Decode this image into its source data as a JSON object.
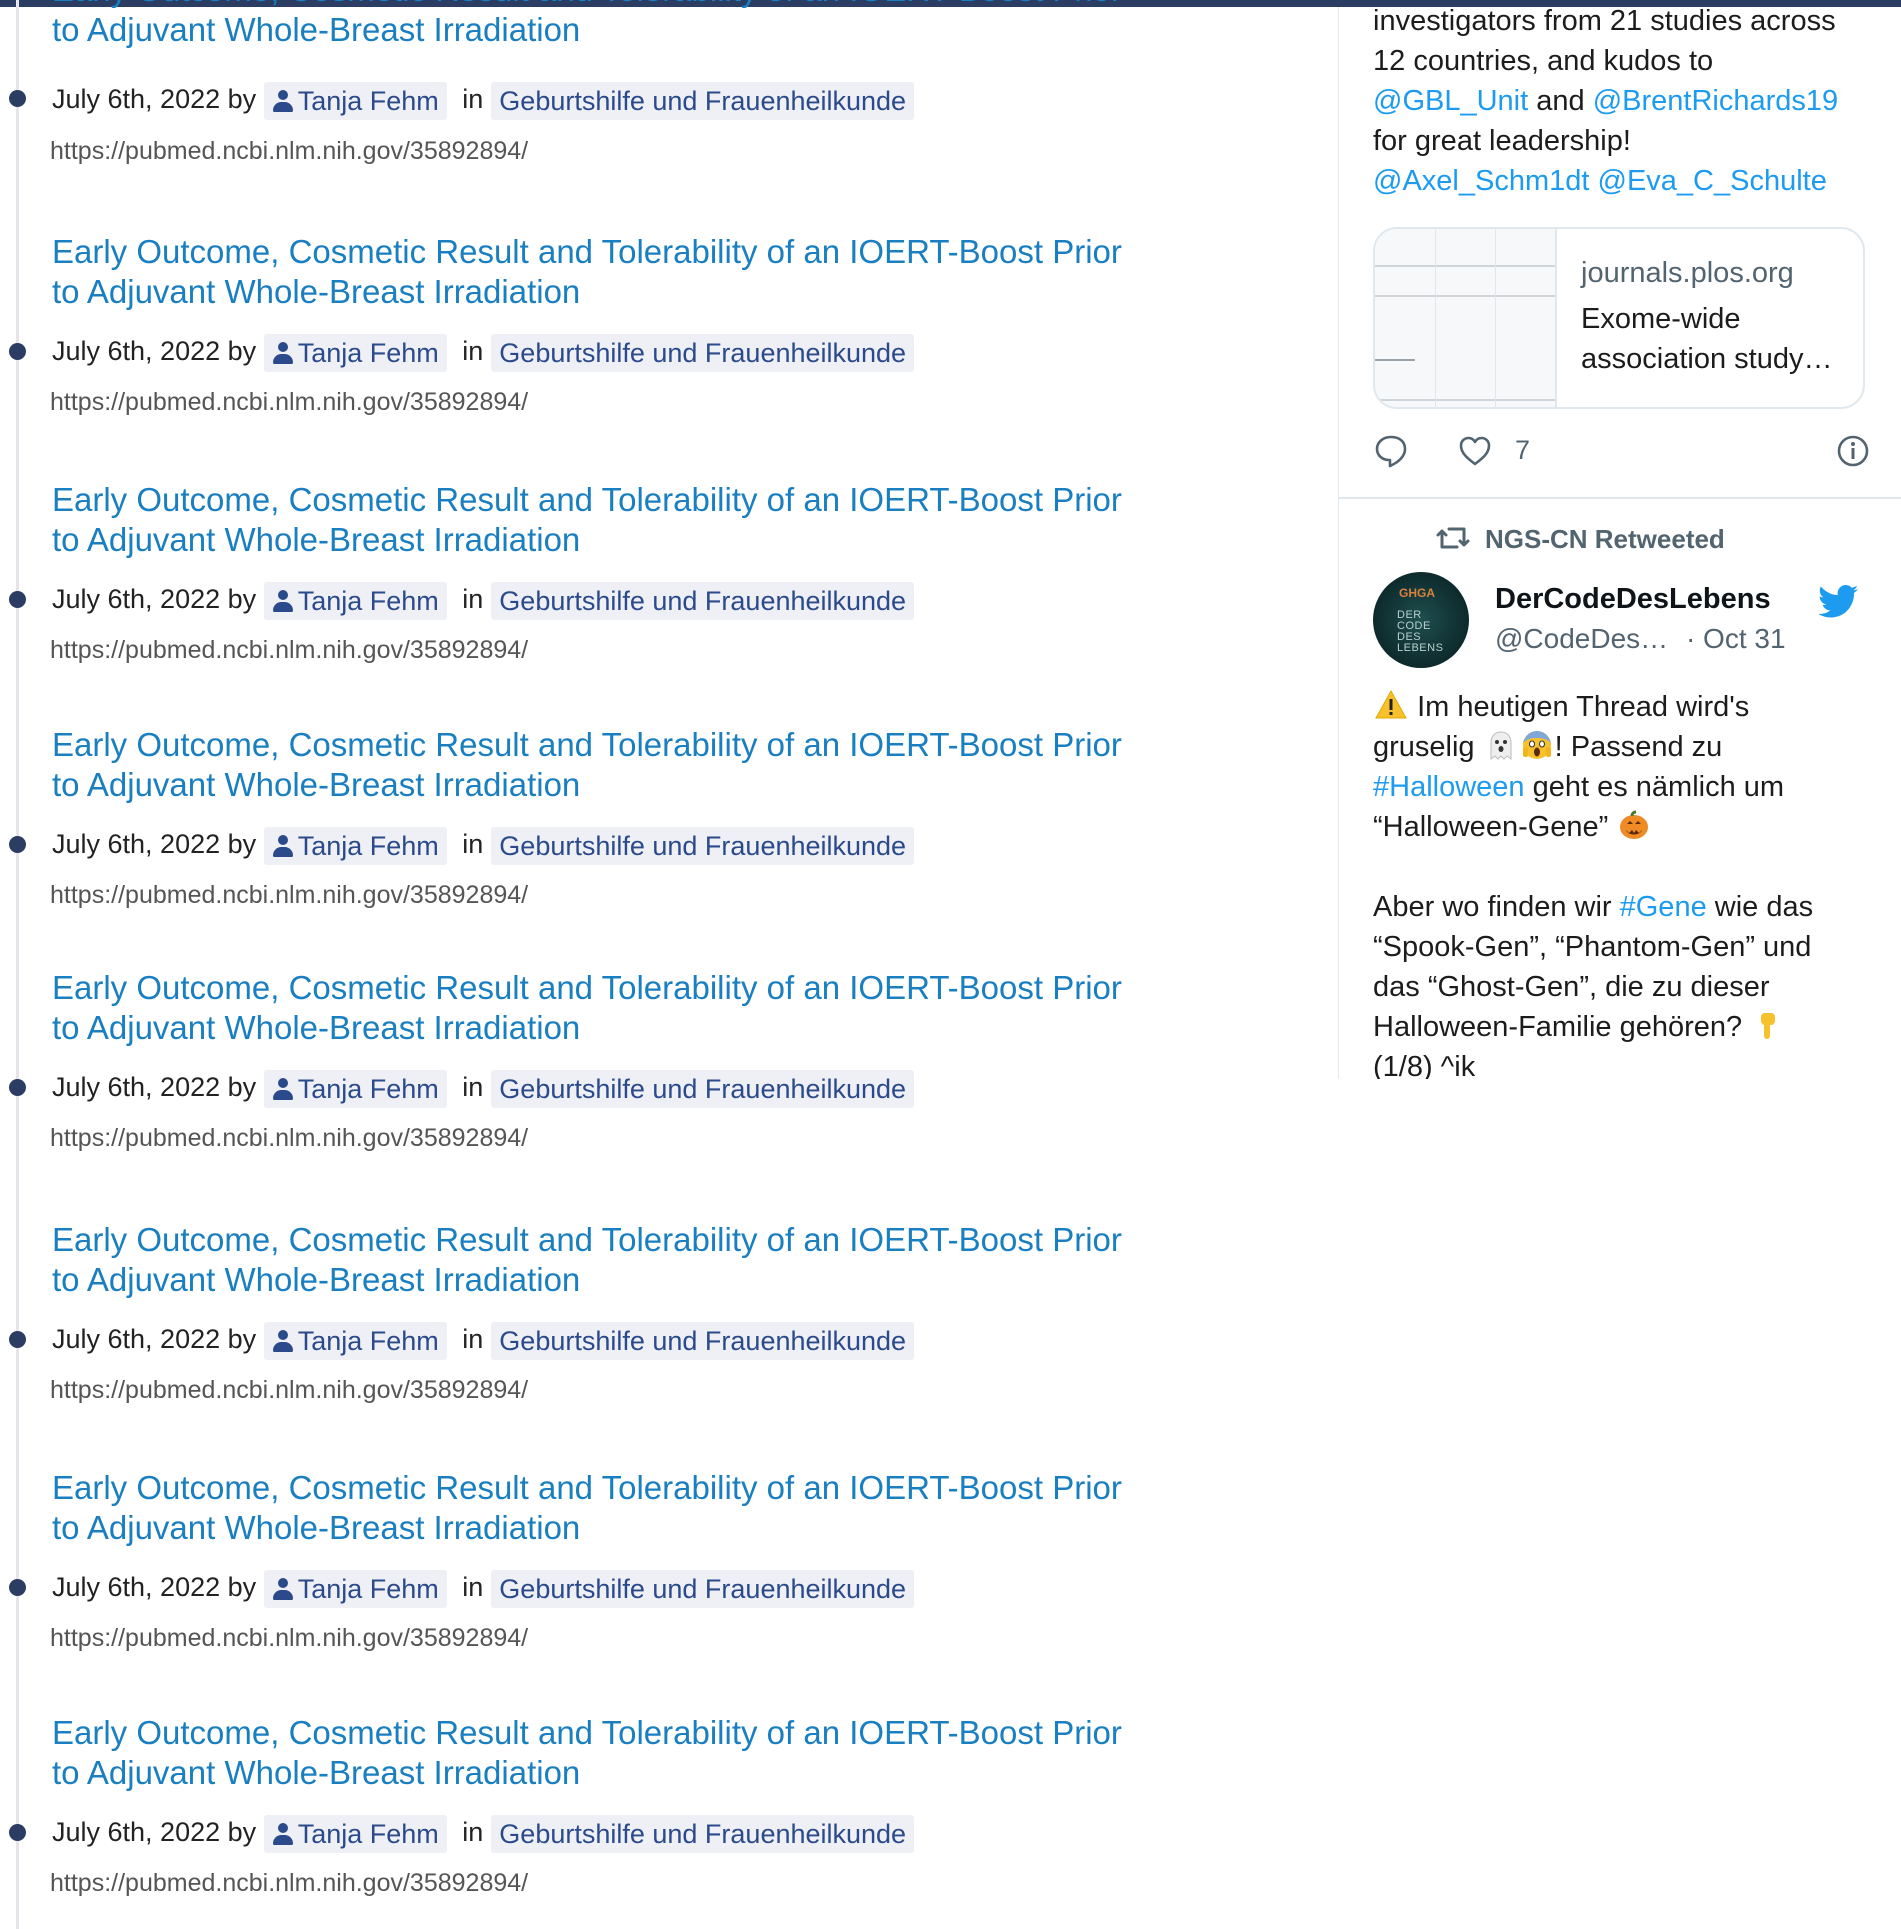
{
  "posts": [
    {
      "title": "Early Outcome, Cosmetic Result and Tolerability of an IOERT-Boost Prior to Adjuvant Whole-Breast Irradiation",
      "date": "July 6th, 2022",
      "by": "by",
      "author": "Tanja Fehm",
      "in": "in",
      "category": "Geburtshilfe und Frauenheilkunde",
      "url": "https://pubmed.ncbi.nlm.nih.gov/35892894/"
    },
    {
      "title": "Early Outcome, Cosmetic Result and Tolerability of an IOERT-Boost Prior to Adjuvant Whole-Breast Irradiation",
      "date": "July 6th, 2022",
      "by": "by",
      "author": "Tanja Fehm",
      "in": "in",
      "category": "Geburtshilfe und Frauenheilkunde",
      "url": "https://pubmed.ncbi.nlm.nih.gov/35892894/"
    },
    {
      "title": "Early Outcome, Cosmetic Result and Tolerability of an IOERT-Boost Prior to Adjuvant Whole-Breast Irradiation",
      "date": "July 6th, 2022",
      "by": "by",
      "author": "Tanja Fehm",
      "in": "in",
      "category": "Geburtshilfe und Frauenheilkunde",
      "url": "https://pubmed.ncbi.nlm.nih.gov/35892894/"
    },
    {
      "title": "Early Outcome, Cosmetic Result and Tolerability of an IOERT-Boost Prior to Adjuvant Whole-Breast Irradiation",
      "date": "July 6th, 2022",
      "by": "by",
      "author": "Tanja Fehm",
      "in": "in",
      "category": "Geburtshilfe und Frauenheilkunde",
      "url": "https://pubmed.ncbi.nlm.nih.gov/35892894/"
    },
    {
      "title": "Early Outcome, Cosmetic Result and Tolerability of an IOERT-Boost Prior to Adjuvant Whole-Breast Irradiation",
      "date": "July 6th, 2022",
      "by": "by",
      "author": "Tanja Fehm",
      "in": "in",
      "category": "Geburtshilfe und Frauenheilkunde",
      "url": "https://pubmed.ncbi.nlm.nih.gov/35892894/"
    },
    {
      "title": "Early Outcome, Cosmetic Result and Tolerability of an IOERT-Boost Prior to Adjuvant Whole-Breast Irradiation",
      "date": "July 6th, 2022",
      "by": "by",
      "author": "Tanja Fehm",
      "in": "in",
      "category": "Geburtshilfe und Frauenheilkunde",
      "url": "https://pubmed.ncbi.nlm.nih.gov/35892894/"
    },
    {
      "title": "Early Outcome, Cosmetic Result and Tolerability of an IOERT-Boost Prior to Adjuvant Whole-Breast Irradiation",
      "date": "July 6th, 2022",
      "by": "by",
      "author": "Tanja Fehm",
      "in": "in",
      "category": "Geburtshilfe und Frauenheilkunde",
      "url": "https://pubmed.ncbi.nlm.nih.gov/35892894/"
    },
    {
      "title": "Early Outcome, Cosmetic Result and Tolerability of an IOERT-Boost Prior to Adjuvant Whole-Breast Irradiation",
      "date": "July 6th, 2022",
      "by": "by",
      "author": "Tanja Fehm",
      "in": "in",
      "category": "Geburtshilfe und Frauenheilkunde",
      "url": "https://pubmed.ncbi.nlm.nih.gov/35892894/"
    }
  ],
  "twitter": {
    "tweet1": {
      "line1": "investigators from 21 studies across",
      "line2": "12 countries, and kudos to",
      "mention1": "@GBL_Unit",
      "and": "and",
      "mention2": "@BrentRichards19",
      "line4": "for great leadership!",
      "mention3": "@Axel_Schm1dt",
      "mention4": "@Eva_C_Schulte",
      "card_domain": "journals.plos.org",
      "card_title": "Exome-wide association study…",
      "like_count": "7",
      "icons": [
        "reply-icon",
        "heart-icon",
        "info-icon"
      ]
    },
    "retweet_label": "NGS-CN Retweeted",
    "tweet2": {
      "name": "DerCodeDesLebens",
      "handle": "@CodeDes…",
      "date": "· Oct 31",
      "avatar_top": "GHGA",
      "avatar_text": "DER CODE DES LEBENS",
      "p1_a": "Im heutigen Thread wird's",
      "p1_b": "gruselig",
      "p1_c": "! Passend zu",
      "hashtag1": "#Halloween",
      "p1_d": "geht es nämlich um",
      "p1_e": "“Halloween-Gene”",
      "p2_a": "Aber wo finden wir",
      "hashtag2": "#Gene",
      "p2_b": "wie das",
      "p2_c": "“Spook-Gen”, “Phantom-Gen” und",
      "p2_d": "das “Ghost-Gen”, die zu dieser",
      "p2_e": "Halloween-Familie gehören?",
      "p2_f": "(1/8) ^ik",
      "icons": [
        "warning-icon",
        "ghost-icon",
        "scream-icon",
        "pumpkin-icon",
        "pointing-down-icon",
        "twitter-bird-icon",
        "retweet-icon"
      ]
    }
  },
  "colors": {
    "accent": "#1a7fc1",
    "brand_dark": "#2b3d63",
    "twitter_blue": "#1d9bf0"
  }
}
